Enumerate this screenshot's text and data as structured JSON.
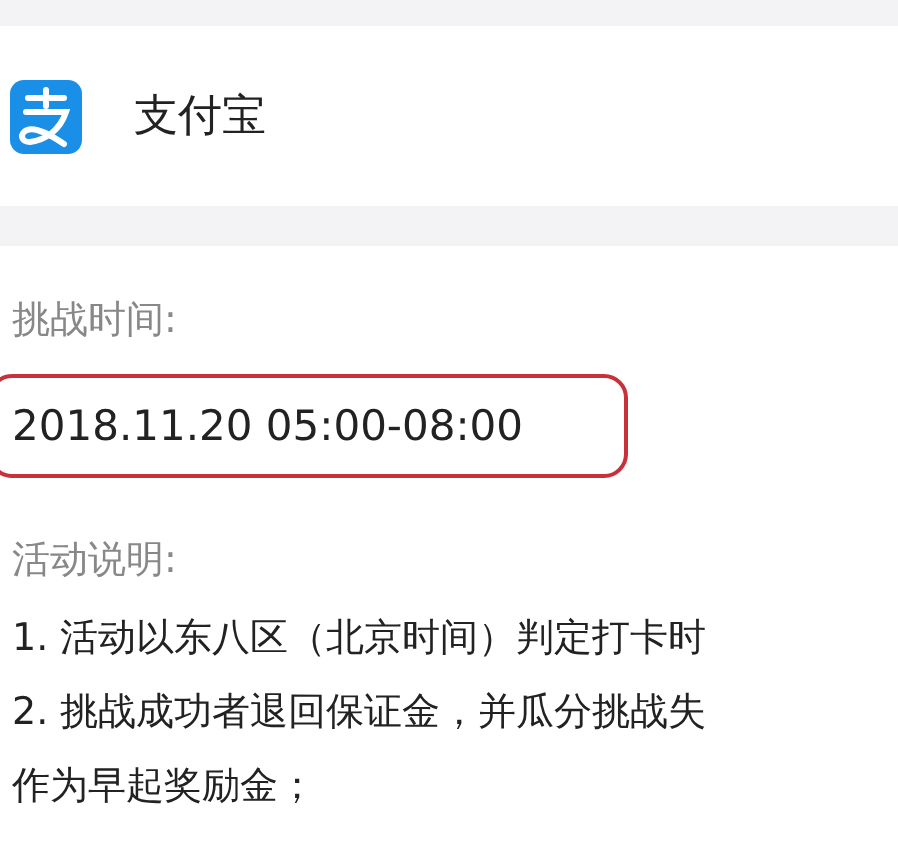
{
  "app": {
    "name": "支付宝"
  },
  "challenge_time": {
    "label": "挑战时间:",
    "value": "2018.11.20 05:00-08:00",
    "highlighted": true
  },
  "description": {
    "label": "活动说明:",
    "lines": [
      "1. 活动以东八区（北京时间）判定打卡时",
      "2. 挑战成功者退回保证金，并瓜分挑战失",
      "作为早起奖励金；"
    ]
  }
}
